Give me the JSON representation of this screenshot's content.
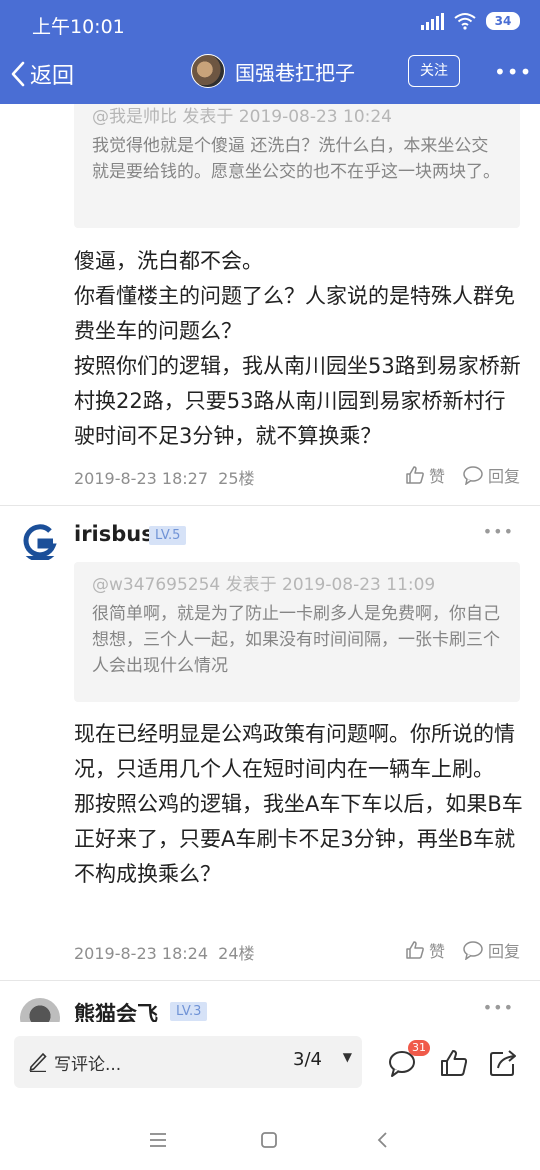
{
  "status": {
    "time": "上午10:01",
    "battery": "34"
  },
  "nav": {
    "back_label": "返回",
    "title": "国强巷扛把子",
    "follow_label": "关注",
    "more": "•••"
  },
  "posts": [
    {
      "quote_header": "@我是帅比 发表于 2019-08-23 10:24",
      "quote_text": "我觉得他就是个傻逼 还洗白？洗什么白，本来坐公交就是要给钱的。愿意坐公交的也不在乎这一块两块了。",
      "paragraphs": [
        "傻逼，洗白都不会。",
        "你看懂楼主的问题了么？人家说的是特殊人群免费坐车的问题么？",
        "按照你们的逻辑，我从南川园坐53路到易家桥新村换22路，只要53路从南川园到易家桥新村行驶时间不足3分钟，就不算换乘？"
      ],
      "date": "2019-8-23 18:27",
      "floor": "25楼",
      "like_label": "赞",
      "reply_label": "回复"
    },
    {
      "username": "irisbus",
      "level": "LV.5",
      "more": "•••",
      "quote_header": "@w347695254 发表于 2019-08-23 11:09",
      "quote_text": "很简单啊，就是为了防止一卡刷多人是免费啊，你自己想想，三个人一起，如果没有时间间隔，一张卡刷三个人会出现什么情况",
      "paragraphs": [
        "现在已经明显是公鸡政策有问题啊。你所说的情况，只适用几个人在短时间内在一辆车上刷。",
        "那按照公鸡的逻辑，我坐A车下车以后，如果B车正好来了，只要A车刷卡不足3分钟，再坐B车就不构成换乘么？"
      ],
      "date": "2019-8-23 18:24",
      "floor": "24楼",
      "like_label": "赞",
      "reply_label": "回复"
    },
    {
      "username": "熊猫会飞",
      "level": "LV.3",
      "more": "•••"
    }
  ],
  "composer": {
    "placeholder": "写评论...",
    "page": "3/4",
    "comment_badge": "31"
  },
  "colors": {
    "accent": "#4a6ed4",
    "level_bg": "#d6e2f7",
    "level_text": "#7093d6",
    "badge": "#f05a4a"
  }
}
